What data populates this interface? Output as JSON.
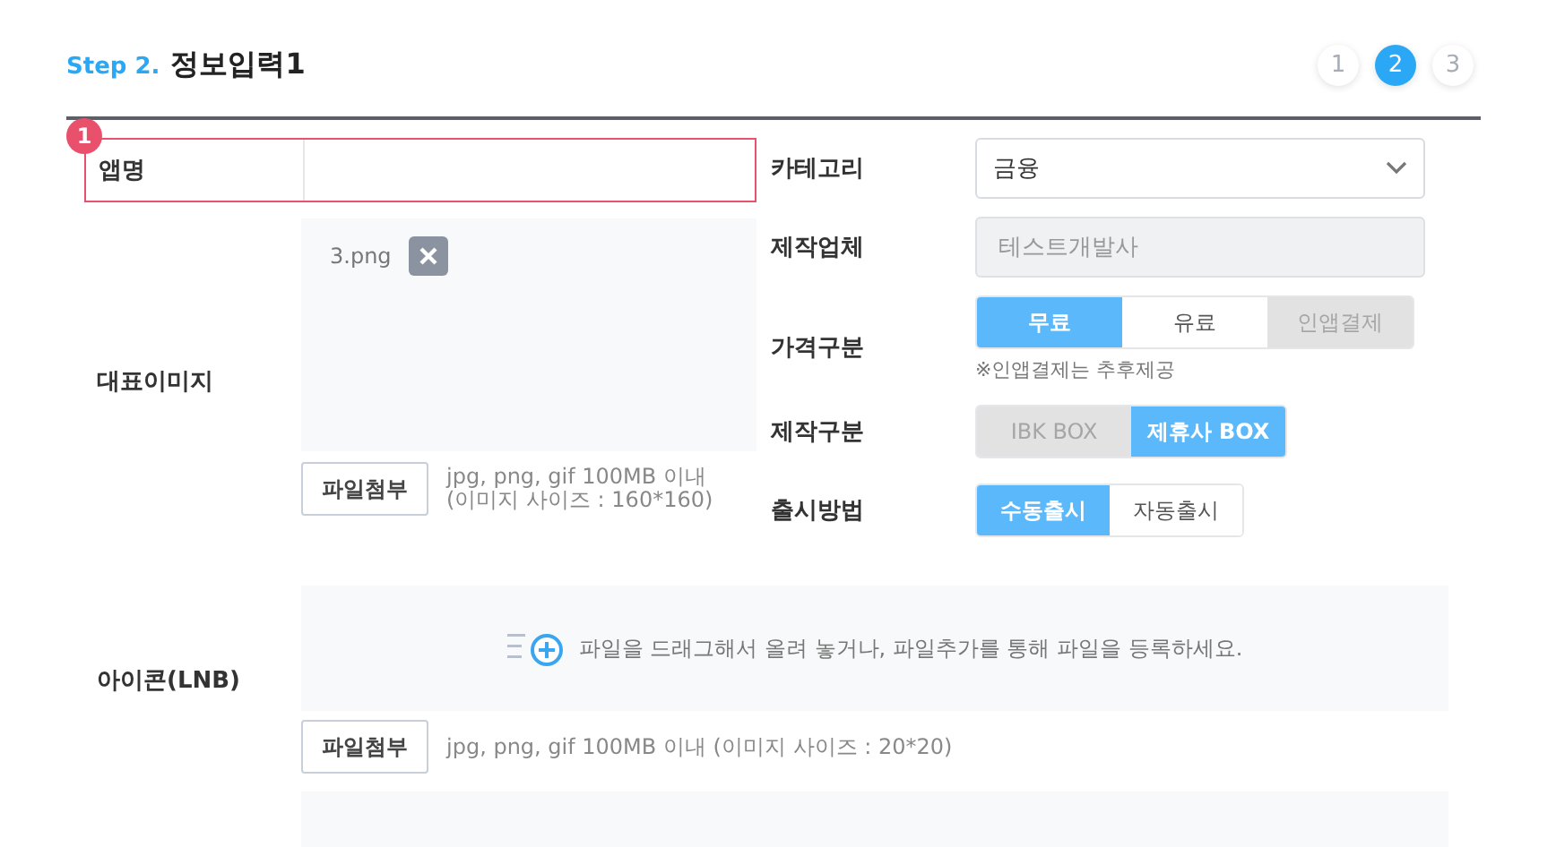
{
  "header": {
    "step": "Step 2.",
    "title": "정보입력1",
    "steps": [
      {
        "label": "1",
        "selected": false
      },
      {
        "label": "2",
        "selected": true
      },
      {
        "label": "3",
        "selected": false
      }
    ]
  },
  "left": {
    "app_name": {
      "badge": "1",
      "label": "앱명",
      "highlighted": true
    },
    "image": {
      "label": "대표이미지",
      "file": "3.png",
      "button": "파일첨부",
      "hint": [
        "jpg, png, gif 100MB 이내",
        "(이미지 사이즈 : 160*160)"
      ]
    }
  },
  "right": {
    "category": {
      "label": "카테고리",
      "value": "금융"
    },
    "maker": {
      "label": "제작업체",
      "value": "테스트개발사",
      "disabled": true
    },
    "price": {
      "label": "가격구분",
      "options": [
        {
          "label": "무료",
          "selected": true,
          "disabled": false
        },
        {
          "label": "유료",
          "selected": false,
          "disabled": false
        },
        {
          "label": "인앱결제",
          "selected": false,
          "disabled": true
        }
      ],
      "note": "※인앱결제는 추후제공"
    },
    "production": {
      "label": "제작구분",
      "options": [
        {
          "label": "IBK BOX",
          "selected": false,
          "disabled": true
        },
        {
          "label": "제휴사 BOX",
          "selected": true,
          "disabled": false
        }
      ]
    },
    "release": {
      "label": "출시방법",
      "options": [
        {
          "label": "수동출시",
          "selected": true,
          "disabled": false
        },
        {
          "label": "자동출시",
          "selected": false,
          "disabled": false
        }
      ]
    }
  },
  "icon_lnb": {
    "label": "아이콘(LNB)",
    "dropzone": "파일을 드래그해서 올려 놓거나, 파일추가를 통해 파일을 등록하세요.",
    "button": "파일첨부",
    "hint": "jpg, png, gif 100MB 이내 (이미지 사이즈 : 20*20)"
  }
}
